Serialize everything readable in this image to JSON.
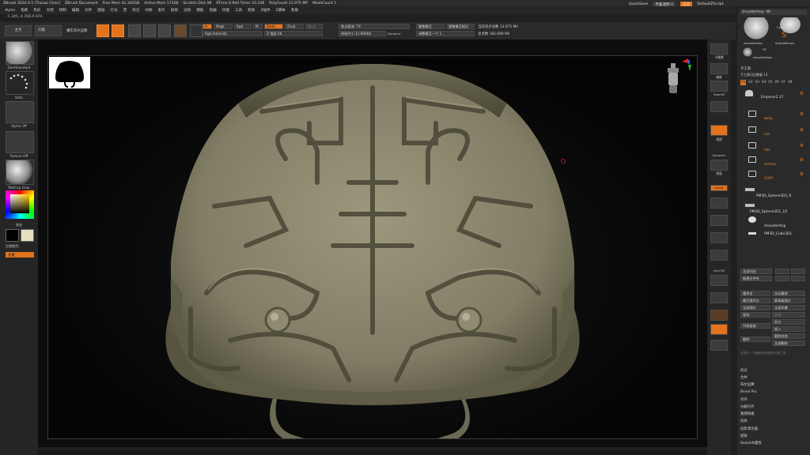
{
  "titlebar": {
    "items": [
      "ZBrush 2024.0.1 [Tianao Chen]",
      "ZBrush Document",
      "Free Mem 41.345GB",
      "Active Mem 17168",
      "Scratch Disk 98",
      "RTime 0.944 Timer 15.236",
      "PolyCount 13.975 MP",
      "MeshCount 1"
    ]
  },
  "topright": {
    "quicksave": "QuickSave",
    "transparency": "界面透明 0",
    "menus_btn": "菜单",
    "script": "DefaultZScript"
  },
  "menubar": {
    "items": [
      "Alpha",
      "笔刷",
      "色彩",
      "文档",
      "绘制",
      "编辑",
      "文件",
      "图层",
      "灯光",
      "宏",
      "标记",
      "材质",
      "影片",
      "拾取",
      "渲染",
      "模板",
      "笔触",
      "纹理",
      "工具",
      "变换",
      "Z插件",
      "Z脚本",
      "帮助"
    ]
  },
  "coords": "-1.345,-4.356,0.874",
  "toolrow": {
    "home": "主页",
    "lightbox": "灯箱",
    "liveboolean": "槽实布尔运算",
    "a_label": "A",
    "mrgb": "Mrgb",
    "rgb": "Rgb",
    "m": "M",
    "zadd": "Zadd",
    "zsub": "Zsub",
    "zcut": "Zcut",
    "rgb_intensity": "Rgb Intensity",
    "z_intensity": "Z 强度 68",
    "focal_shift": "焦点衰减 -74",
    "draw_size": "绘制大小 11.69084",
    "dynamic": "Dynamic",
    "sel_btn1": "重整最后",
    "sel_btn2": "重整最后相对",
    "sel_adj": "调整最后一个 1",
    "active_points": "当前顶点总数 13.975 Mil",
    "total_points": "总点数 182.699 Mil"
  },
  "leftshelf": {
    "brush": "DamStandard",
    "dots": "Dots",
    "alpha": "Alpha Off",
    "texture": "Texture Off",
    "material": "MatCap Gray",
    "gradient": "渐变",
    "switch_color": "切换颜色",
    "alternate": "交替"
  },
  "rightstrip": {
    "labels": [
      "子像素",
      "缩放",
      "ZoomD",
      "",
      "透视",
      "Dynamic",
      "地面",
      "Ghost",
      "",
      "",
      "",
      "Line Fill",
      "",
      "",
      "",
      ""
    ]
  },
  "rpanel": {
    "tool_name": "shoulderltop. 48",
    "thumbs": [
      "shoulderltop",
      "Cylinder3D",
      "SimpleBrush",
      "shoulderltop"
    ],
    "thumb_count": "35",
    "subtool_header": "子工具",
    "visible_count": "子工具可见数量 13",
    "tabs": [
      "V1",
      "V2",
      "V3",
      "V4",
      "V5",
      "V6",
      "V7",
      "V8"
    ],
    "items": [
      {
        "name": "Emperor2.17",
        "type": "mesh"
      },
      {
        "name": "body",
        "type": "folder"
      },
      {
        "name": "cos",
        "type": "folder"
      },
      {
        "name": "hat",
        "type": "folder"
      },
      {
        "name": "armour",
        "type": "folder"
      },
      {
        "name": "COPY",
        "type": "folder"
      },
      {
        "name": "PM3D_Sphere3D1_9",
        "type": "mesh"
      },
      {
        "name": "PM3D_Sphere3D1_10",
        "type": "mesh"
      },
      {
        "name": "shoulderltop",
        "type": "mesh"
      },
      {
        "name": "PM3D_Cube3D1",
        "type": "mesh"
      }
    ],
    "buttons_a": [
      "全部列出",
      "新建文件夹"
    ],
    "buttons_b": [
      "重命名",
      "自动重排",
      "最后操作分",
      "最高级细分",
      "全部细分",
      "全部折叠",
      "复制",
      "插值",
      "列群复制",
      "拆分",
      "插入",
      "删除",
      "删除其他",
      "全部删除"
    ],
    "hint": "将鼠标一个编程扭转结果在列表工具",
    "list": [
      "拆分",
      "合并",
      "布尔运算",
      "Bevel Pro",
      "对齐",
      "分解对齐",
      "重建网格",
      "投射",
      "投影演示器",
      "提取",
      "Redshift属性"
    ]
  },
  "colors": {
    "accent": "#e3731c",
    "bg": "#1f1f1f",
    "panel": "#2a2a2a",
    "model": "#8a876f"
  }
}
